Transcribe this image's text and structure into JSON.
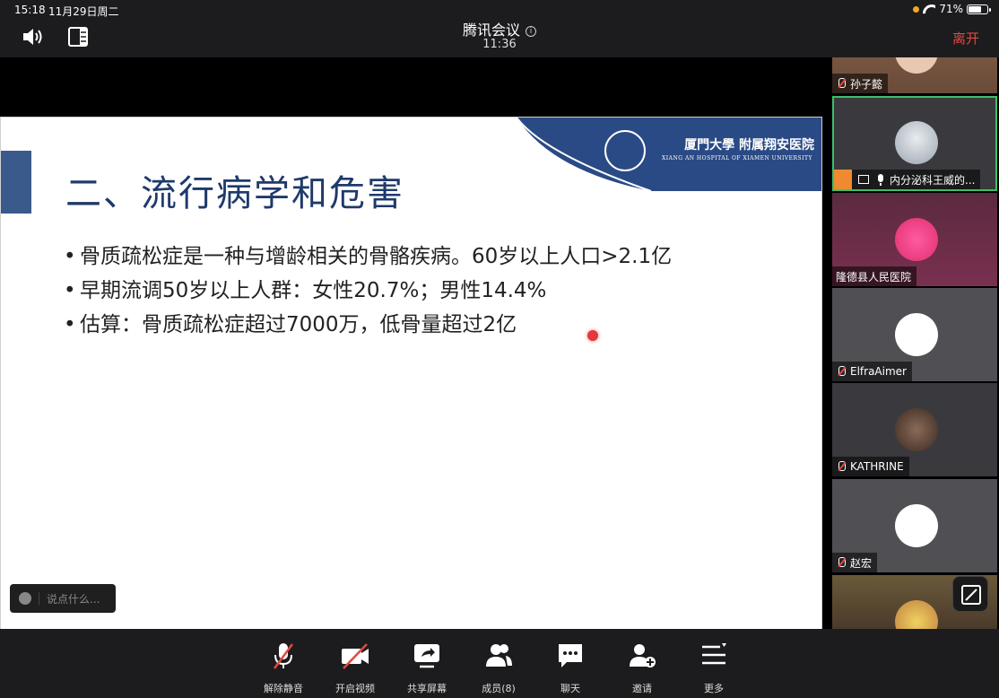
{
  "status_bar": {
    "time": "15:18",
    "date": "11月29日周二",
    "battery": "71%"
  },
  "header": {
    "title": "腾讯会议",
    "timer": "11:36",
    "leave_label": "离开"
  },
  "slide": {
    "title": "二、流行病学和危害",
    "logo_text": "厦門大學 附属翔安医院",
    "logo_sub": "XIANG AN HOSPITAL OF XIAMEN UNIVERSITY",
    "bullets": [
      "骨质疏松症是一种与增龄相关的骨骼疾病。60岁以上人口>2.1亿",
      "早期流调50岁以上人群：女性20.7%；男性14.4%",
      "估算：骨质疏松症超过7000万，低骨量超过2亿"
    ]
  },
  "chat": {
    "placeholder": "说点什么..."
  },
  "participants": [
    {
      "name": "孙子懿",
      "mic": "muted"
    },
    {
      "name": "内分泌科王威的...",
      "mic": "on"
    },
    {
      "name": "隆德县人民医院",
      "mic": "none"
    },
    {
      "name": "ElfraAimer",
      "mic": "muted"
    },
    {
      "name": "KATHRINE",
      "mic": "muted"
    },
    {
      "name": "赵宏",
      "mic": "muted"
    }
  ],
  "toolbar": {
    "unmute": "解除静音",
    "video": "开启视频",
    "share": "共享屏幕",
    "members": "成员(8)",
    "chat": "聊天",
    "invite": "邀请",
    "more": "更多"
  },
  "colors": {
    "leave": "#e5483f",
    "slide_blue": "#3a5a8c",
    "slide_title": "#1f3a6a",
    "active_border": "#3ac06a"
  }
}
